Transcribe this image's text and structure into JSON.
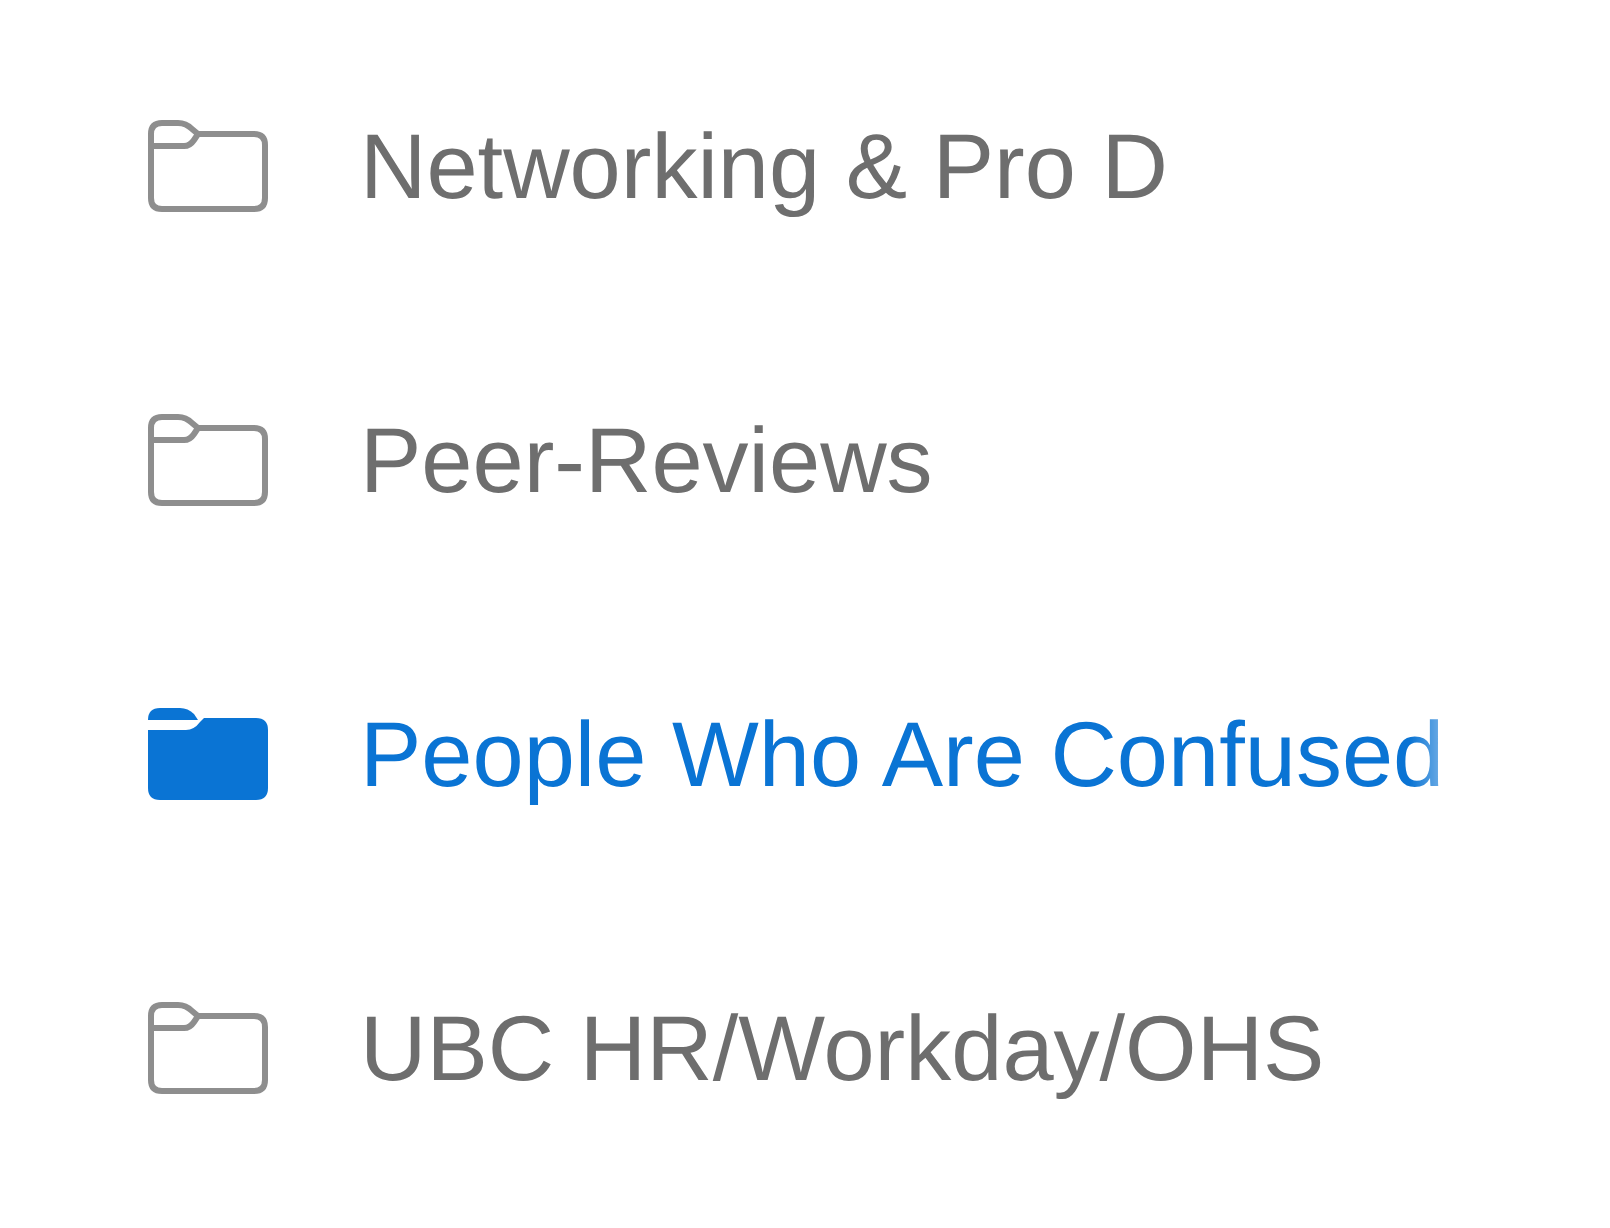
{
  "folders": [
    {
      "name": "Networking & Pro D",
      "selected": false
    },
    {
      "name": "Peer-Reviews",
      "selected": false
    },
    {
      "name": "People Who Are Confused",
      "selected": true
    },
    {
      "name": "UBC HR/Workday/OHS",
      "selected": false
    }
  ]
}
